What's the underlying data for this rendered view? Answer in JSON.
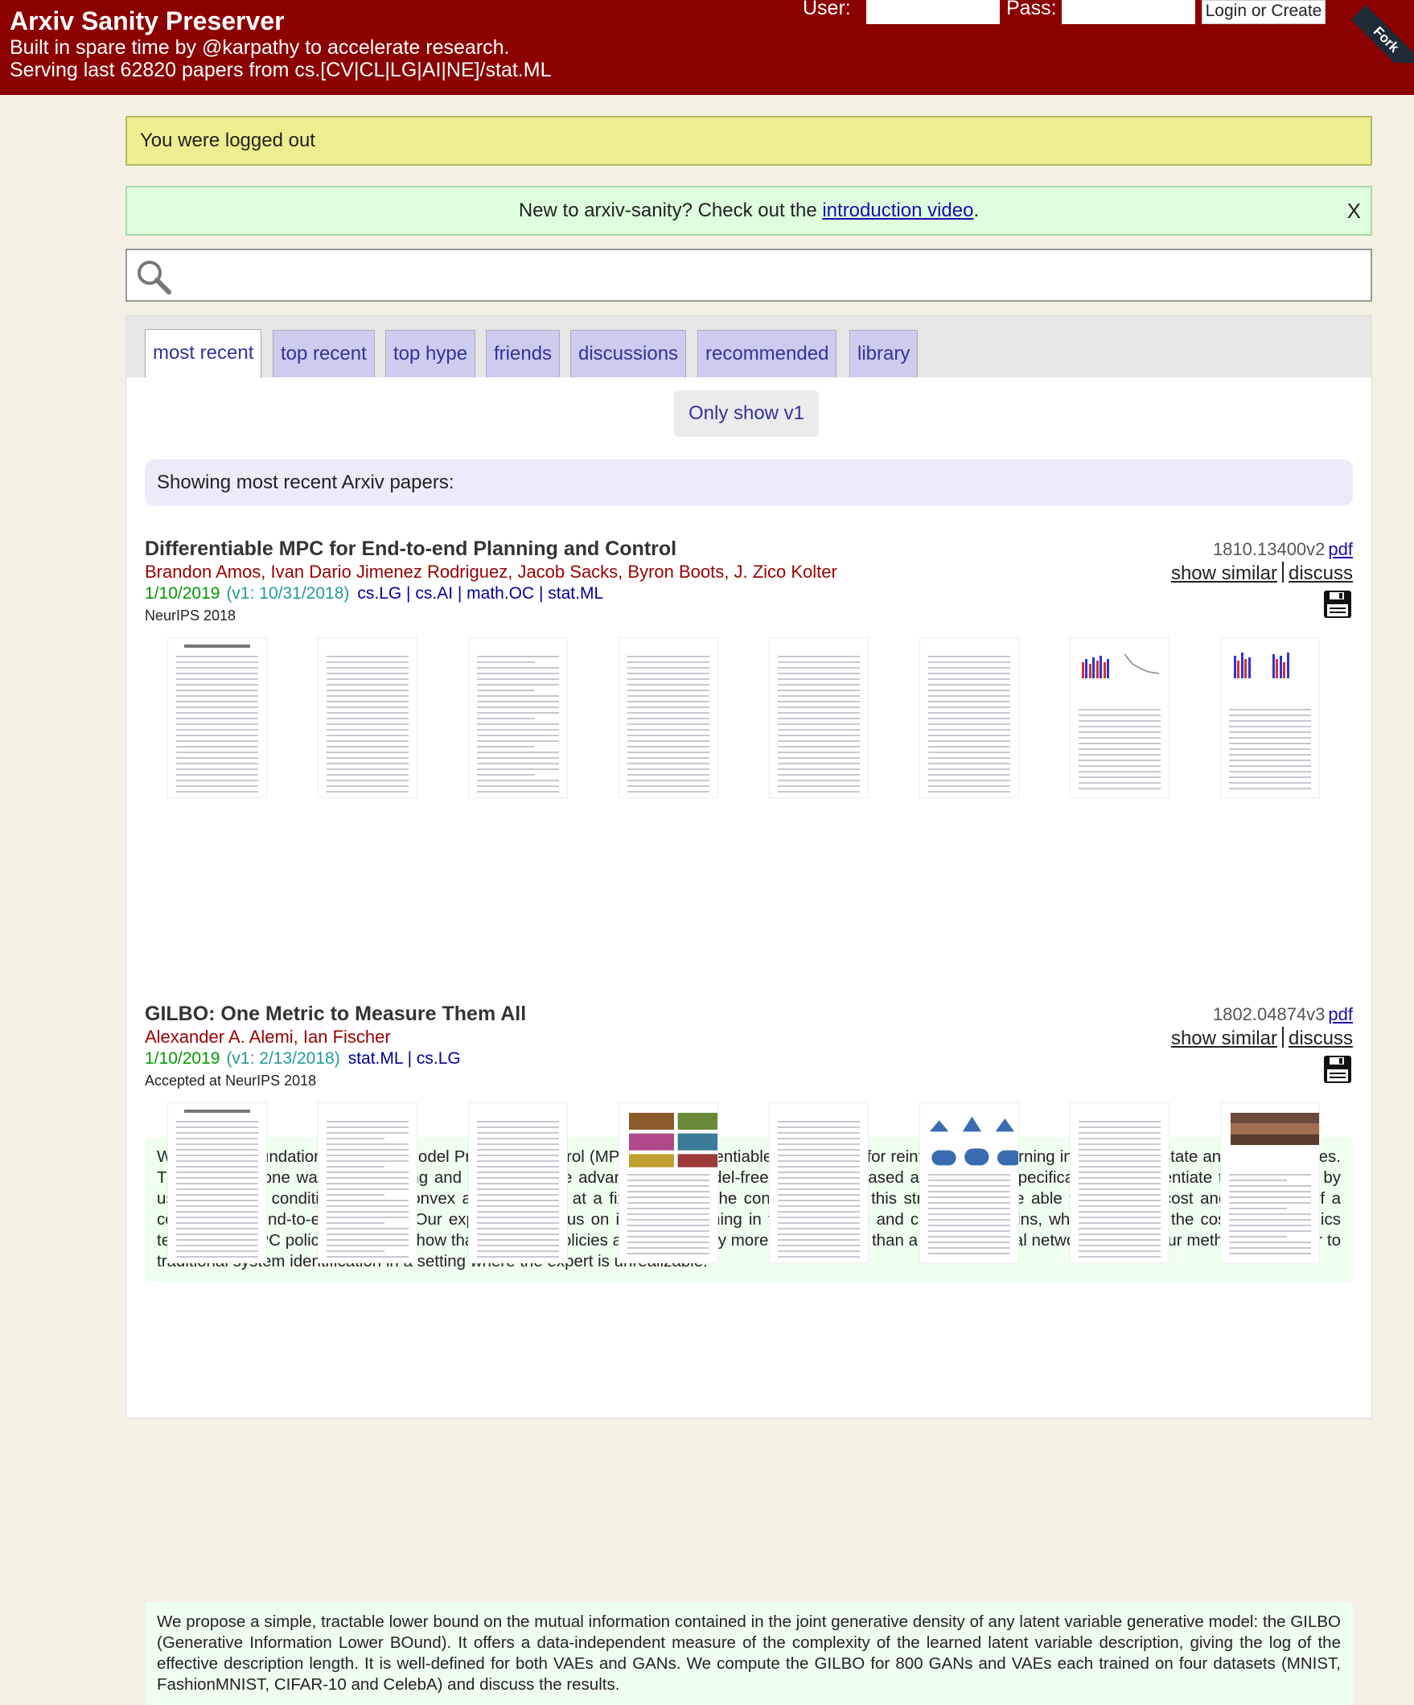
{
  "header": {
    "title": "Arxiv Sanity Preserver",
    "subtitle1": "Built in spare time by @karpathy to accelerate research.",
    "subtitle2": "Serving last 62820 papers from cs.[CV|CL|LG|AI|NE]/stat.ML",
    "user_label": "User:",
    "pass_label": "Pass:",
    "login_button": "Login or Create",
    "ribbon_text": "Fork"
  },
  "flash": {
    "message": "You were logged out"
  },
  "intro": {
    "text_before": "New to arxiv-sanity? Check out the ",
    "link_text": "introduction video",
    "text_after": ".",
    "close": "X"
  },
  "search": {
    "value": "",
    "placeholder": ""
  },
  "tabs": [
    {
      "label": "most recent",
      "active": true
    },
    {
      "label": "top recent",
      "active": false
    },
    {
      "label": "top hype",
      "active": false
    },
    {
      "label": "friends",
      "active": false
    },
    {
      "label": "discussions",
      "active": false
    },
    {
      "label": "recommended",
      "active": false
    },
    {
      "label": "library",
      "active": false
    }
  ],
  "only_v1": "Only show v1",
  "showing": "Showing most recent Arxiv papers:",
  "papers": [
    {
      "title": "Differentiable MPC for End-to-end Planning and Control",
      "authors": "Brandon Amos, Ivan Dario Jimenez Rodriguez, Jacob Sacks, Byron Boots, J. Zico Kolter",
      "date": "1/10/2019",
      "v1_date": "(v1: 10/31/2018)",
      "categories": "cs.LG | cs.AI | math.OC | stat.ML",
      "comment": "NeurIPS 2018",
      "arxiv_id": "1810.13400v2",
      "pdf_label": "pdf",
      "show_similar": "show similar",
      "discuss": "discuss",
      "save_icon": "floppy-disk-icon",
      "abstract": "We present foundations for using Model Predictive Control (MPC) as a differentiable policy class for reinforcement learning in continuous state and action spaces. This provides one way of leveraging and combining the advantages of model-free and model-based approaches. Specifically, we differentiate through MPC by using the KKT conditions of the convex approximation at a fixed point of the controller. Using this strategy, we are able to learn the cost and dynamics of a controller via end-to-end learning. Our experiments focus on imitation learning in the pendulum and cartpole domains, where we learn the cost and dynamics terms of an MPC policy class. We show that our MPC policies are significantly more data-efficient than a generic neural network and that our method is superior to traditional system identification in a setting where the expert is unrealizable."
    },
    {
      "title": "GILBO: One Metric to Measure Them All",
      "authors": "Alexander A. Alemi, Ian Fischer",
      "date": "1/10/2019",
      "v1_date": "(v1: 2/13/2018)",
      "categories": "stat.ML | cs.LG",
      "comment": "Accepted at NeurIPS 2018",
      "arxiv_id": "1802.04874v3",
      "pdf_label": "pdf",
      "show_similar": "show similar",
      "discuss": "discuss",
      "save_icon": "floppy-disk-icon",
      "abstract": "We propose a simple, tractable lower bound on the mutual information contained in the joint generative density of any latent variable generative model: the GILBO (Generative Information Lower BOund). It offers a data-independent measure of the complexity of the learned latent variable description, giving the log of the effective description length. It is well-defined for both VAEs and GANs. We compute the GILBO for 800 GANs and VAEs each trained on four datasets (MNIST, FashionMNIST, CIFAR-10 and CelebA) and discuss the results."
    }
  ],
  "colors": {
    "header_bg": "#8b0000",
    "page_bg": "#f4f1e4",
    "flash_bg": "#eeee90",
    "intro_bg": "#ddffdd",
    "tab_bg": "#ccccee",
    "abstract_bg": "#efffef"
  }
}
